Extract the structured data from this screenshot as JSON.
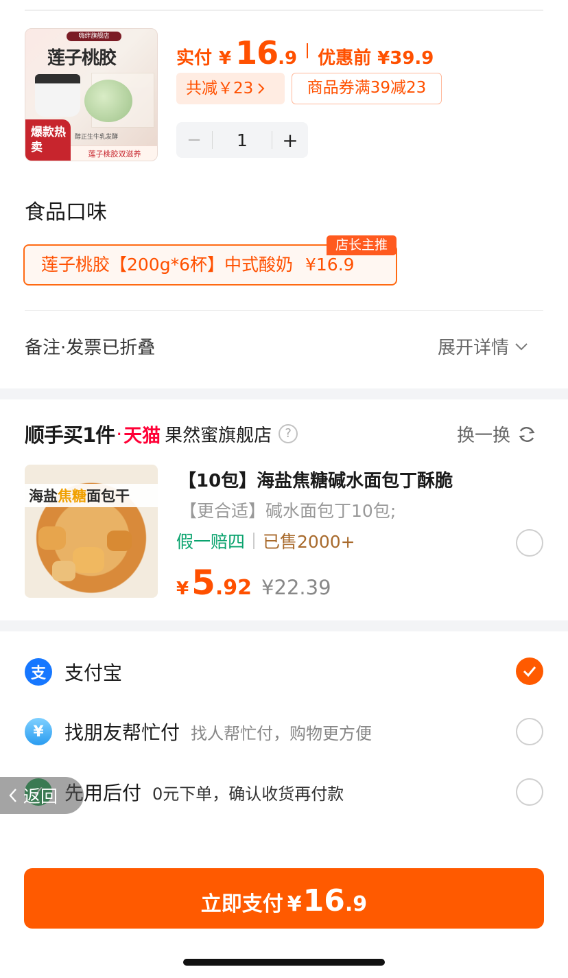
{
  "product": {
    "thumb": {
      "shop_label": "嗨绊旗舰店",
      "brand_text": "莲子桃胶",
      "badge_hot": "爆款热卖",
      "tagline": "莲子桃胶双滋养",
      "sub_note": "醇正生牛乳发酵"
    },
    "actual_label": "实付",
    "currency": "¥",
    "actual_int": "16",
    "actual_dec": ".9",
    "original_label": "优惠前 ¥39.9",
    "discount_chip": "共减￥23",
    "coupon_chip": "商品券满39减23",
    "quantity": "1",
    "flavor_title": "食品口味",
    "flavor_option": "莲子桃胶【200g*6杯】中式酸奶",
    "flavor_price": "¥16.9",
    "flavor_badge": "店长主推",
    "note_label": "备注·发票已折叠",
    "expand_label": "展开详情"
  },
  "addon": {
    "title": "顺手买1件",
    "dot": "·",
    "tmall": "天猫",
    "shop": "果然蜜旗舰店",
    "swap_label": "换一换",
    "thumb_text_a": "海盐",
    "thumb_text_b": "焦糖",
    "thumb_text_c": "面包干",
    "name": "【10包】海盐焦糖碱水面包丁酥脆",
    "desc": "【更合适】碱水面包丁10包;",
    "tag_fake": "假一赔四",
    "tag_sold": "已售2000+",
    "currency": "¥",
    "price_int": "5",
    "price_dec": ".92",
    "price_orig": "¥22.39",
    "selected": false
  },
  "payment": {
    "methods": [
      {
        "name": "支付宝",
        "desc": "",
        "selected": true,
        "icon": "alipay-icon"
      },
      {
        "name": "找朋友帮忙付",
        "desc": "找人帮忙付，购物更方便",
        "selected": false,
        "icon": "friend-pay-icon"
      },
      {
        "name": "先用后付",
        "desc": "0元下单，确认收货再付款",
        "selected": false,
        "icon": "pay-later-icon"
      }
    ],
    "back_label": "返回"
  },
  "footer": {
    "pay_label": "立即支付",
    "currency": "¥",
    "total_int": "16",
    "total_dec": ".9"
  },
  "colors": {
    "accent": "#ff5a00",
    "tmall": "#ff0036",
    "fake_tag": "#0aa36e",
    "alipay": "#1677ff"
  }
}
